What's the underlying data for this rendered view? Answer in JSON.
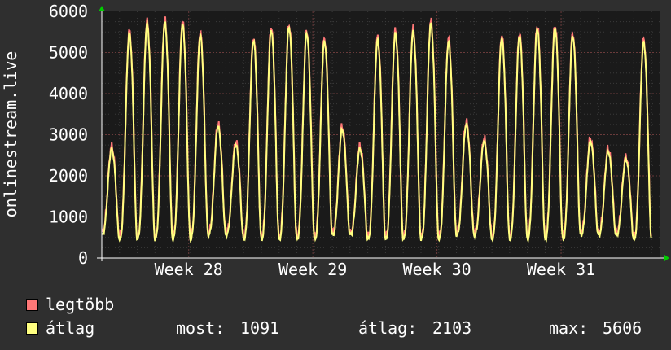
{
  "chart_data": {
    "type": "line",
    "ylabel": "onlinestream.live",
    "ylim": [
      0,
      6000
    ],
    "yticks": [
      0,
      1000,
      2000,
      3000,
      4000,
      5000,
      6000
    ],
    "xlabels": [
      "Week 28",
      "Week 29",
      "Week 30",
      "Week 31"
    ],
    "x_range_days": [
      0,
      31.5
    ],
    "xlabel_days": [
      4.9,
      11.9,
      18.9,
      25.9
    ],
    "days": 31,
    "daily_peaks": [
      2650,
      5450,
      5680,
      5720,
      5680,
      5420,
      3200,
      2760,
      5300,
      5550,
      5620,
      5460,
      5270,
      3120,
      2650,
      5300,
      5460,
      5500,
      5700,
      5250,
      3250,
      2840,
      5350,
      5400,
      5580,
      5600,
      5400,
      2840,
      2590,
      2400,
      5250
    ],
    "series": [
      {
        "name": "legtöbb",
        "color": "#ff7777"
      },
      {
        "name": "átlag",
        "color": "#ffff80"
      }
    ],
    "stats": {
      "most_label": "most:",
      "most": "1091",
      "atlag_label": "átlag:",
      "atlag": "2103",
      "max_label": "max:",
      "max": "5606"
    }
  }
}
